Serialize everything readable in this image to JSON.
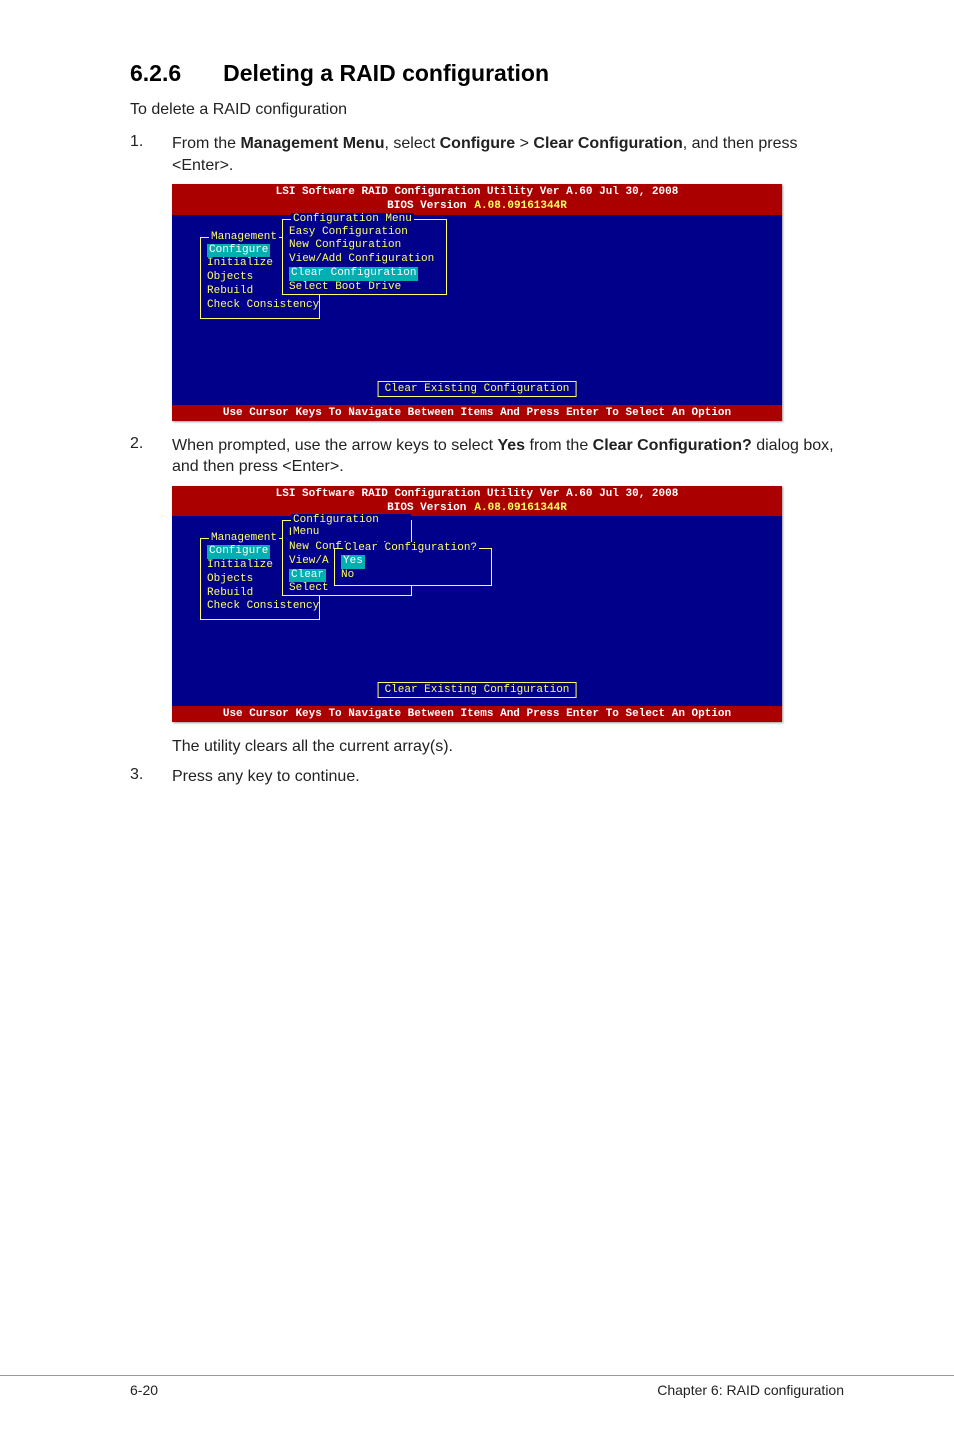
{
  "heading": {
    "number": "6.2.6",
    "title": "Deleting a RAID configuration"
  },
  "intro": "To delete a RAID configuration",
  "steps": {
    "s1": {
      "num": "1.",
      "prefix": "From the ",
      "b1": "Management Menu",
      "mid1": ", select ",
      "b2": "Configure",
      "gt": " > ",
      "b3": "Clear Configuration",
      "suffix": ", and then press <Enter>."
    },
    "s2": {
      "num": "2.",
      "prefix": "When prompted, use the arrow keys to select ",
      "b1": "Yes",
      "mid1": " from the ",
      "b2": "Clear Configuration?",
      "suffix": " dialog box, and then press <Enter>."
    },
    "s3_pre": "The utility clears all the current array(s).",
    "s3": {
      "num": "3.",
      "text": "Press any key to continue."
    }
  },
  "bios": {
    "title_line1": "LSI Software RAID Configuration Utility Ver A.60 Jul 30, 2008",
    "title_line2_label": "BIOS Version",
    "title_line2_value": "A.08.09161344R",
    "mgmt_panel_title": "Management",
    "mgmt_items": {
      "configure": "Configure",
      "initialize": "Initialize",
      "objects": "Objects",
      "rebuild": "Rebuild",
      "check": "Check Consistency"
    },
    "cfg_panel_title": "Configuration Menu",
    "cfg_items": {
      "easy": "Easy Configuration",
      "new": "New Configuration",
      "viewadd": "View/Add Configuration",
      "clear": "Clear Configuration",
      "selectboot": "Select Boot Drive"
    },
    "cfg_items_trunc": {
      "viewa": "View/A",
      "clear_short": "Clear",
      "select_short": "Select"
    },
    "clear_panel_title": "Clear Configuration?",
    "clear_items": {
      "yes": "Yes",
      "no": "No"
    },
    "desc": "Clear Existing Configuration",
    "footer": "Use Cursor Keys To Navigate Between Items And Press Enter To Select An Option"
  },
  "footer": {
    "left": "6-20",
    "right": "Chapter 6: RAID configuration"
  }
}
